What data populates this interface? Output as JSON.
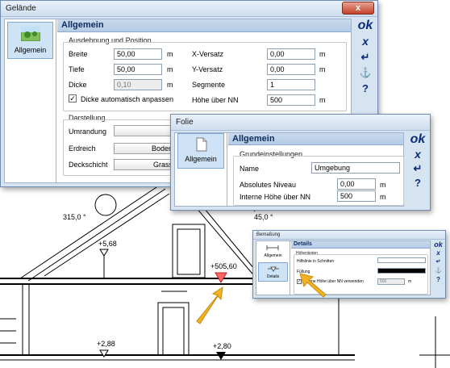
{
  "drawing": {
    "angle_left": "315,0 °",
    "angle_right": "45,0 °",
    "level_568": "+5,68",
    "level_50560": "+505,60",
    "level_288": "+2,88",
    "level_280": "+2,80"
  },
  "gelaende": {
    "title": "Gelände",
    "close": "x",
    "side_item": "Allgemein",
    "header": "Allgemein",
    "group1": "Ausdehnung und Position",
    "breite_label": "Breite",
    "breite_value": "50,00",
    "tiefe_label": "Tiefe",
    "tiefe_value": "50,00",
    "dicke_label": "Dicke",
    "dicke_value": "0,10",
    "unit_m": "m",
    "xversatz_label": "X-Versatz",
    "xversatz_value": "0,00",
    "yversatz_label": "Y-Versatz",
    "yversatz_value": "0,00",
    "segmente_label": "Segmente",
    "segmente_value": "1",
    "hoehe_label": "Höhe über NN",
    "hoehe_value": "500",
    "dicke_auto_label": "Dicke automatisch anpassen",
    "group2": "Darstellung",
    "umrandung_label": "Umrandung",
    "erdreich_label": "Erdreich",
    "erdreich_value": "Boden",
    "deckschicht_label": "Deckschicht",
    "deckschicht_value": "Grass"
  },
  "folie": {
    "title": "Folie",
    "side_item": "Allgemein",
    "header": "Allgemein",
    "group1": "Grundeinstellungen",
    "name_label": "Name",
    "name_value": "Umgebung",
    "abs_niveau_label": "Absolutes Niveau",
    "abs_niveau_value": "0,00",
    "int_hoehe_label": "Interne Höhe über NN",
    "int_hoehe_value": "500",
    "unit_m": "m"
  },
  "bemassung": {
    "title": "Bemaßung",
    "side_item1": "Allgemein",
    "side_item2": "Details",
    "header": "Details",
    "group1": "Höhenkoten",
    "hilfslinie_label": "Hilfslinie in Schnitten",
    "fuellung_label": "Füllung",
    "interne_label": "Interne Höhe über NN verwenden",
    "interne_value": "500",
    "unit_m": "m"
  },
  "toolbar": {
    "ok": "ok",
    "cancel": "x",
    "apply": "↵",
    "anchor": "⚓",
    "help": "?"
  },
  "colors": {
    "marker_red": "#ff6666",
    "arrow_yellow": "#f2b320",
    "title_blue": "#0c2b5e"
  }
}
